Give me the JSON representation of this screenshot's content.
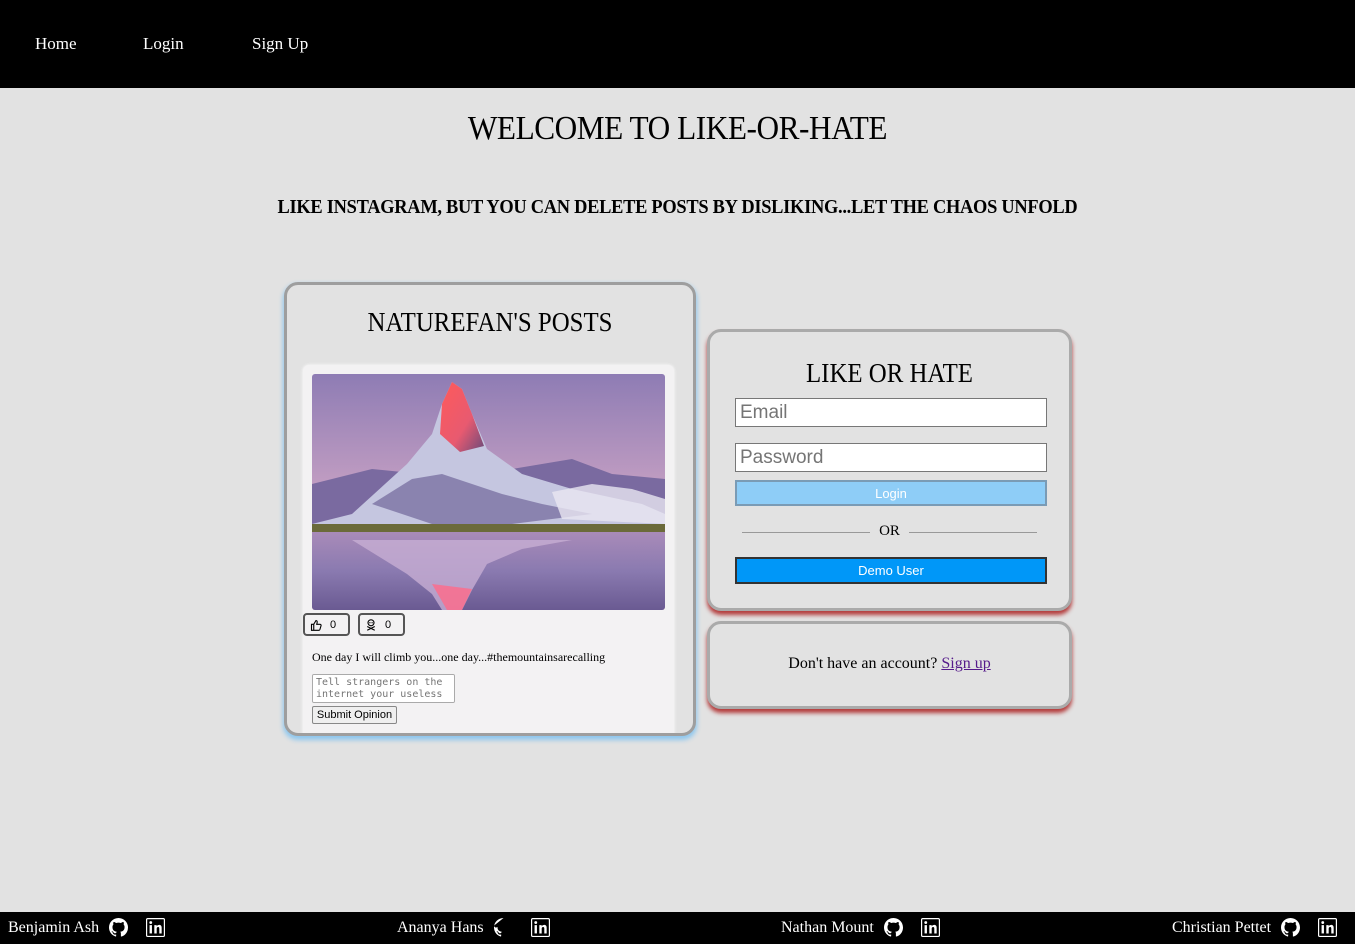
{
  "nav": {
    "home": "Home",
    "login": "Login",
    "signup": "Sign Up"
  },
  "main": {
    "title": "WELCOME TO LIKE-OR-HATE",
    "tagline": "LIKE INSTAGRAM, BUT YOU CAN DELETE POSTS BY DISLIKING...LET THE CHAOS UNFOLD"
  },
  "posts": {
    "title": "NATUREFAN'S POSTS",
    "post": {
      "likes": "0",
      "hates": "0",
      "caption": "One day I will climb you...one day...#themountainsarecalling",
      "opinion_placeholder": "Tell strangers on the internet your useless",
      "submit_label": "Submit Opinion"
    }
  },
  "login_form": {
    "title": "LIKE OR HATE",
    "email_placeholder": "Email",
    "password_placeholder": "Password",
    "login_label": "Login",
    "or_text": "OR",
    "demo_label": "Demo User"
  },
  "signup": {
    "prompt": "Don't have an account?",
    "link": "Sign up"
  },
  "footer": {
    "developers": [
      "Benjamin Ash",
      "Ananya Hans",
      "Nathan Mount",
      "Christian Pettet"
    ]
  },
  "colors": {
    "nav_bg": "#000000",
    "page_bg": "#e2e2e2",
    "login_button": "#8ecdf7",
    "demo_button": "#0097f8",
    "card_shadow_red": "#b43c3c",
    "card_shadow_blue": "#8ec7ee"
  },
  "icons": [
    "thumbs-up-icon",
    "skull-crossbones-icon",
    "github-icon",
    "linkedin-icon"
  ]
}
